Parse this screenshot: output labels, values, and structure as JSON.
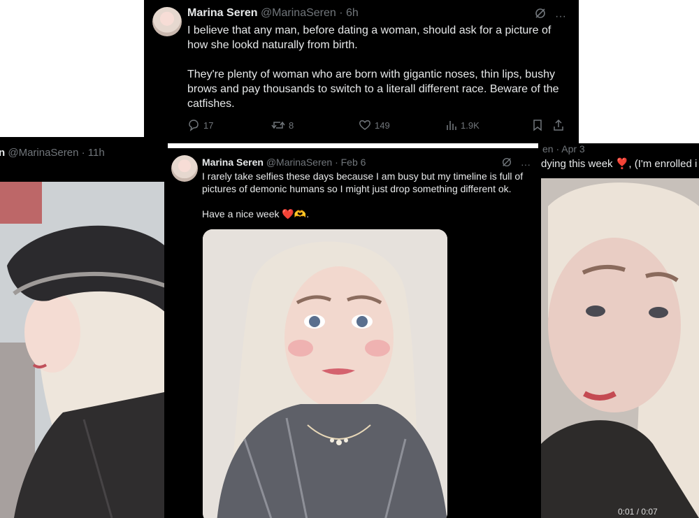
{
  "tweet_top": {
    "name": "Marina Seren",
    "handle": "@MarinaSeren · 6h",
    "paragraph1": "I believe that any man, before dating a woman, should ask for a picture of how she lookd naturally from birth.",
    "paragraph2": "They're plenty of woman who are born with gigantic noses, thin lips, bushy brows and pay thousands to switch to a literall different race. Beware of the catfishes.",
    "replies": "17",
    "reposts": "8",
    "likes": "149",
    "views": "1.9K",
    "more": "···"
  },
  "tweet_left": {
    "name_partial": "n",
    "handle": "@MarinaSeren · 11h"
  },
  "tweet_middle": {
    "name": "Marina Seren",
    "handle": "@MarinaSeren · Feb 6",
    "paragraph1": "I rarely take selfies these days because I am busy but my timeline is full of pictures of demonic humans so I might just drop something different ok.",
    "paragraph2": "Have a nice week ❤️🫶.",
    "more": "···"
  },
  "tweet_right": {
    "handle_partial": "en · Apr 3",
    "text_partial": "dying this week ❣️, (I'm enrolled i",
    "video_time": "0:01 / 0:07"
  },
  "colors": {
    "background": "#000000",
    "text": "#e7e9ea",
    "muted": "#71767b"
  },
  "icons": [
    "grok-icon",
    "more-icon",
    "reply-icon",
    "repost-icon",
    "like-icon",
    "views-icon",
    "bookmark-icon",
    "share-icon"
  ]
}
